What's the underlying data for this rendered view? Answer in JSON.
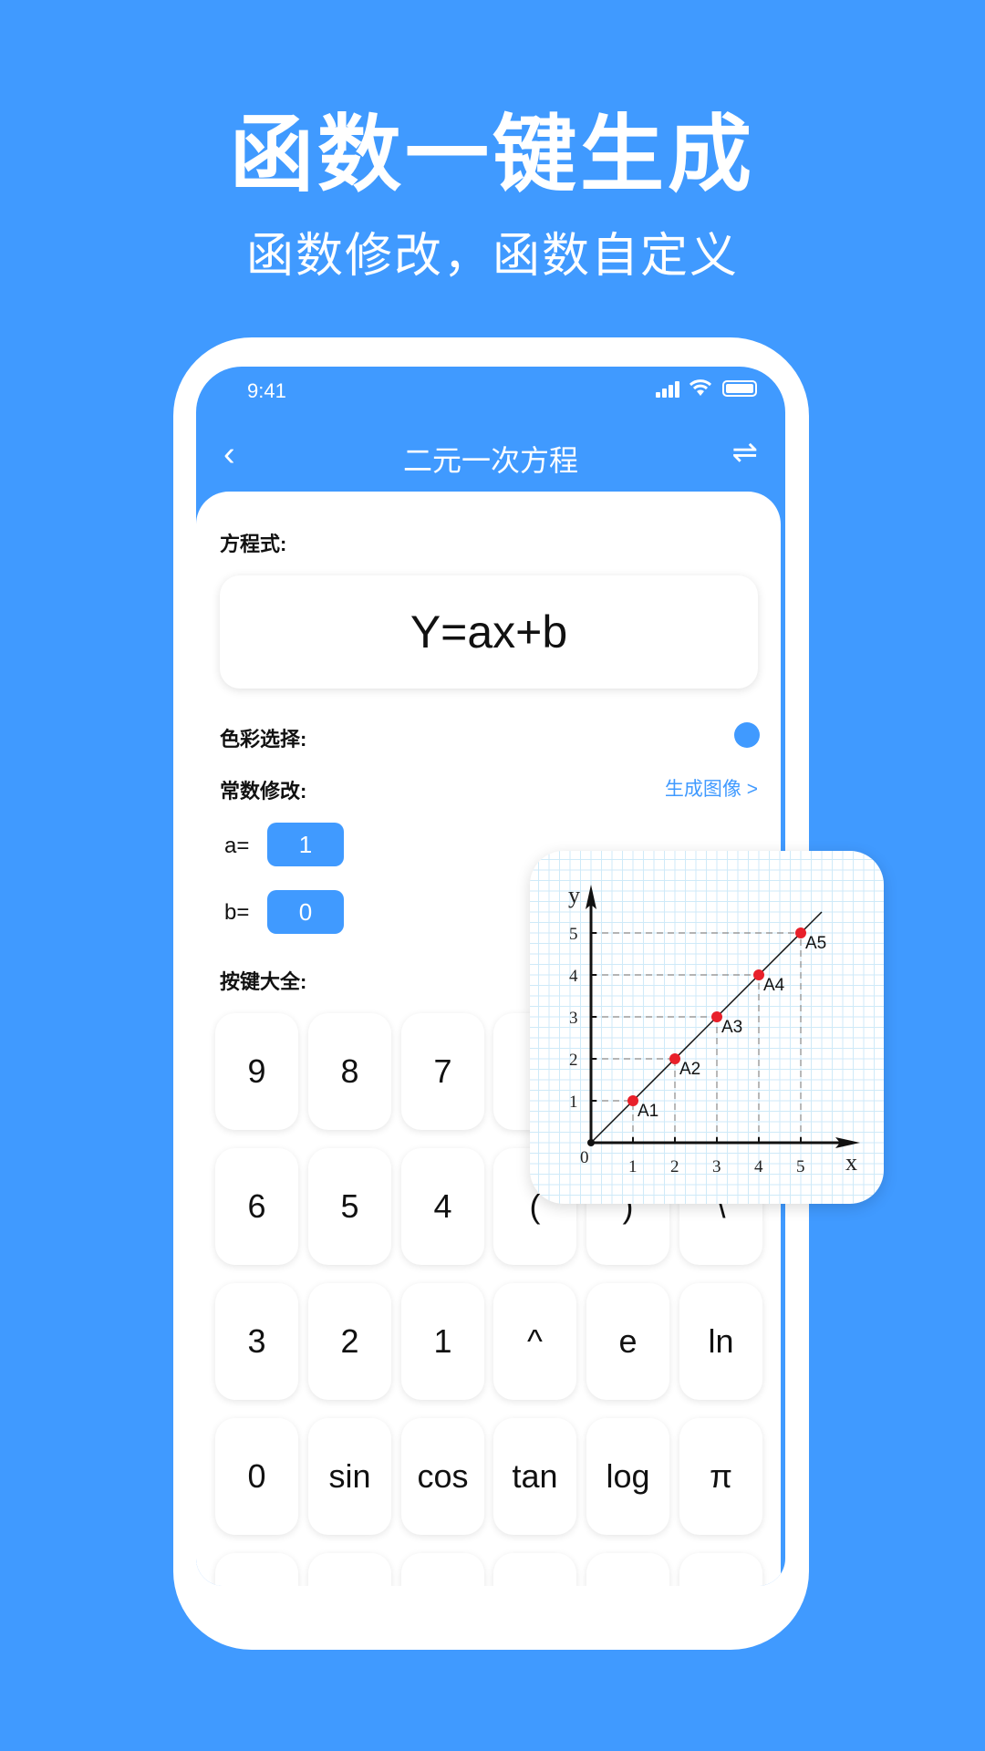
{
  "hero": {
    "title": "函数一键生成",
    "subtitle": "函数修改，函数自定义"
  },
  "status": {
    "time": "9:41"
  },
  "nav": {
    "back_icon": "chevron-left-icon",
    "title": "二元一次方程",
    "swap_icon": "swap-arrows-icon",
    "back": "‹",
    "swap": "⇌"
  },
  "form": {
    "equation_label": "方程式:",
    "equation": "Y=ax+b",
    "color_label": "色彩选择:",
    "color_value": "#409AFF",
    "constants_label": "常数修改:",
    "generate_link": "生成图像 >",
    "a_label": "a=",
    "a_value": "1",
    "b_label": "b=",
    "b_value": "0",
    "keys_label": "按键大全:"
  },
  "keys": [
    [
      "9",
      "8",
      "7",
      "",
      "",
      ""
    ],
    [
      "6",
      "5",
      "4",
      "(",
      ")",
      "\\"
    ],
    [
      "3",
      "2",
      "1",
      "^",
      "e",
      "ln"
    ],
    [
      "0",
      "sin",
      "cos",
      "tan",
      "log",
      "π"
    ],
    [
      "",
      "",
      "",
      "",
      "",
      ""
    ]
  ],
  "colors": {
    "background": "#409AFF",
    "accent": "#409AFF",
    "point": "#E8202A"
  },
  "chart_data": {
    "type": "line",
    "xlabel": "x",
    "ylabel": "y",
    "origin_label": "0",
    "xlim": [
      0,
      5.5
    ],
    "ylim": [
      0,
      5.5
    ],
    "x_ticks": [
      "1",
      "2",
      "3",
      "4",
      "5"
    ],
    "y_ticks": [
      "1",
      "2",
      "3",
      "4",
      "5"
    ],
    "grid": true,
    "points": [
      {
        "label": "A1",
        "x": 1,
        "y": 1
      },
      {
        "label": "A2",
        "x": 2,
        "y": 2
      },
      {
        "label": "A3",
        "x": 3,
        "y": 3
      },
      {
        "label": "A4",
        "x": 4,
        "y": 4
      },
      {
        "label": "A5",
        "x": 5,
        "y": 5
      }
    ]
  }
}
